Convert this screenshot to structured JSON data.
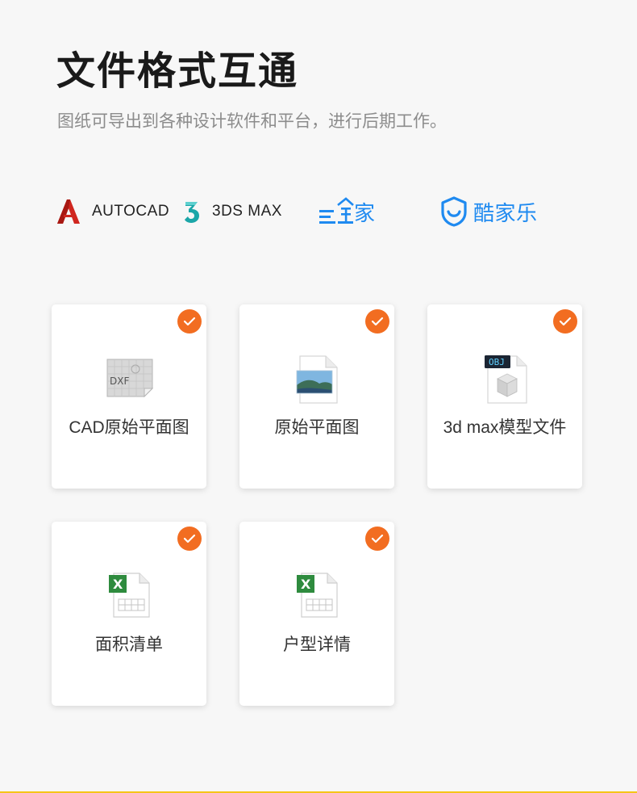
{
  "header": {
    "title": "文件格式互通",
    "subtitle": "图纸可导出到各种设计软件和平台，进行后期工作。"
  },
  "logos": [
    {
      "name": "autocad",
      "label": "AUTOCAD",
      "icon": "autocad-a-icon",
      "color": "#d0261f"
    },
    {
      "name": "3dsmax",
      "label": "3DS MAX",
      "icon": "3dsmax-3-icon",
      "color": "#1ba6a8"
    },
    {
      "name": "sanweijia",
      "label": "家",
      "icon": "house-roof-icon",
      "color": "#1f8af0"
    },
    {
      "name": "kujiale",
      "label": "酷家乐",
      "icon": "shield-smile-icon",
      "color": "#1f8af0"
    }
  ],
  "cards": [
    {
      "label": "CAD原始平面图",
      "icon": "dxf-file-icon",
      "icon_text": "DXF",
      "checked": true
    },
    {
      "label": "原始平面图",
      "icon": "image-file-icon",
      "checked": true
    },
    {
      "label": "3d max模型文件",
      "icon": "obj-file-icon",
      "icon_text": "OBJ",
      "checked": true
    },
    {
      "label": "面积清单",
      "icon": "excel-file-icon",
      "icon_text": "X",
      "checked": true
    },
    {
      "label": "户型详情",
      "icon": "excel-file-icon",
      "icon_text": "X",
      "checked": true
    }
  ],
  "colors": {
    "accent_check": "#f26d21",
    "brand_blue": "#1f8af0",
    "bottom_line": "#f5c518"
  }
}
